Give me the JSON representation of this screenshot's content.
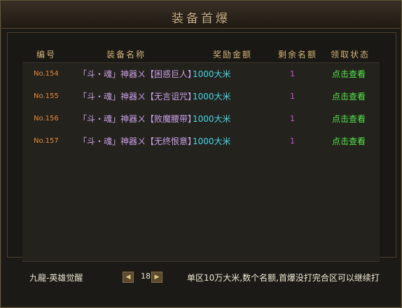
{
  "window": {
    "title": "装备首爆"
  },
  "columns": [
    "编号",
    "装备名称",
    "奖励金额",
    "剩余名额",
    "领取状态"
  ],
  "rows": [
    {
      "no": "No.154",
      "name": "「斗・魂」神器ㄨ【困惑巨人】",
      "reward": "1000大米",
      "remain": "1",
      "status": "点击查看"
    },
    {
      "no": "No.155",
      "name": "「斗・魂」神器ㄨ【无言诅咒】",
      "reward": "1000大米",
      "remain": "1",
      "status": "点击查看"
    },
    {
      "no": "No.156",
      "name": "「斗・魂」神器ㄨ【败魔腰带】",
      "reward": "1000大米",
      "remain": "1",
      "status": "点击查看"
    },
    {
      "no": "No.157",
      "name": "「斗・魂」神器ㄨ【无终恨意】",
      "reward": "1000大米",
      "remain": "1",
      "status": "点击查看"
    }
  ],
  "footer": {
    "server": "九龍-英雄觉醒",
    "prev_icon": "◀",
    "page": "18",
    "next_icon": "▶",
    "note": "单区10万大米,数个名额,首爆没打完合区可以继续打"
  }
}
